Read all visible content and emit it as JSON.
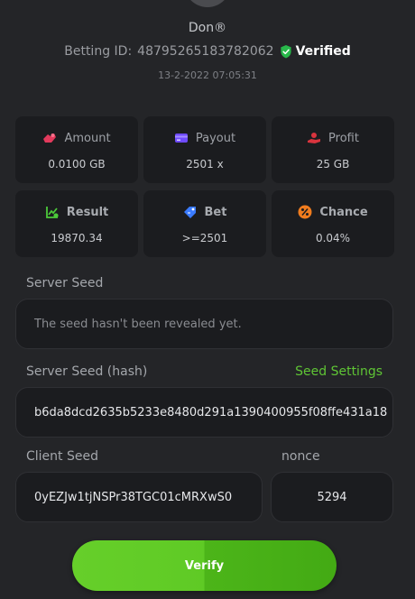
{
  "header": {
    "username": "Don®",
    "betting_label": "Betting ID:",
    "betting_id": "48795265183782062",
    "verified_label": "Verified",
    "datetime": "13-2-2022 07:05:31"
  },
  "stats": [
    {
      "label": "Amount",
      "value": "0.0100 GB",
      "icon": "amount-icon",
      "color": "#e23a5c"
    },
    {
      "label": "Payout",
      "value": "2501 x",
      "icon": "payout-card-icon",
      "color": "#6f4bff"
    },
    {
      "label": "Profit",
      "value": "25 GB",
      "icon": "profit-hand-icon",
      "color": "#d9343e"
    },
    {
      "label": "Result",
      "value": "19870.34",
      "icon": "result-chart-icon",
      "color": "#4cc93a"
    },
    {
      "label": "Bet",
      "value": ">=2501",
      "icon": "bet-tag-icon",
      "color": "#3a7bff"
    },
    {
      "label": "Chance",
      "value": "0.04%",
      "icon": "chance-percent-icon",
      "color": "#f07c1e"
    }
  ],
  "server_seed": {
    "label": "Server Seed",
    "value": "The seed hasn't been revealed yet."
  },
  "server_seed_hash": {
    "label": "Server Seed (hash)",
    "settings_link": "Seed Settings",
    "value": "b6da8dcd2635b5233e8480d291a1390400955f08ffe431a18"
  },
  "client_seed": {
    "label": "Client Seed",
    "value": "0yEZJw1tjNSPr38TGC01cMRXwS0"
  },
  "nonce": {
    "label": "nonce",
    "value": "5294"
  },
  "verify_button": {
    "label": "Verify"
  },
  "colors": {
    "accent": "#5fc535",
    "verified_badge": "#28b84a",
    "card_bg": "#1b1c1f",
    "panel_bg": "#242528"
  }
}
